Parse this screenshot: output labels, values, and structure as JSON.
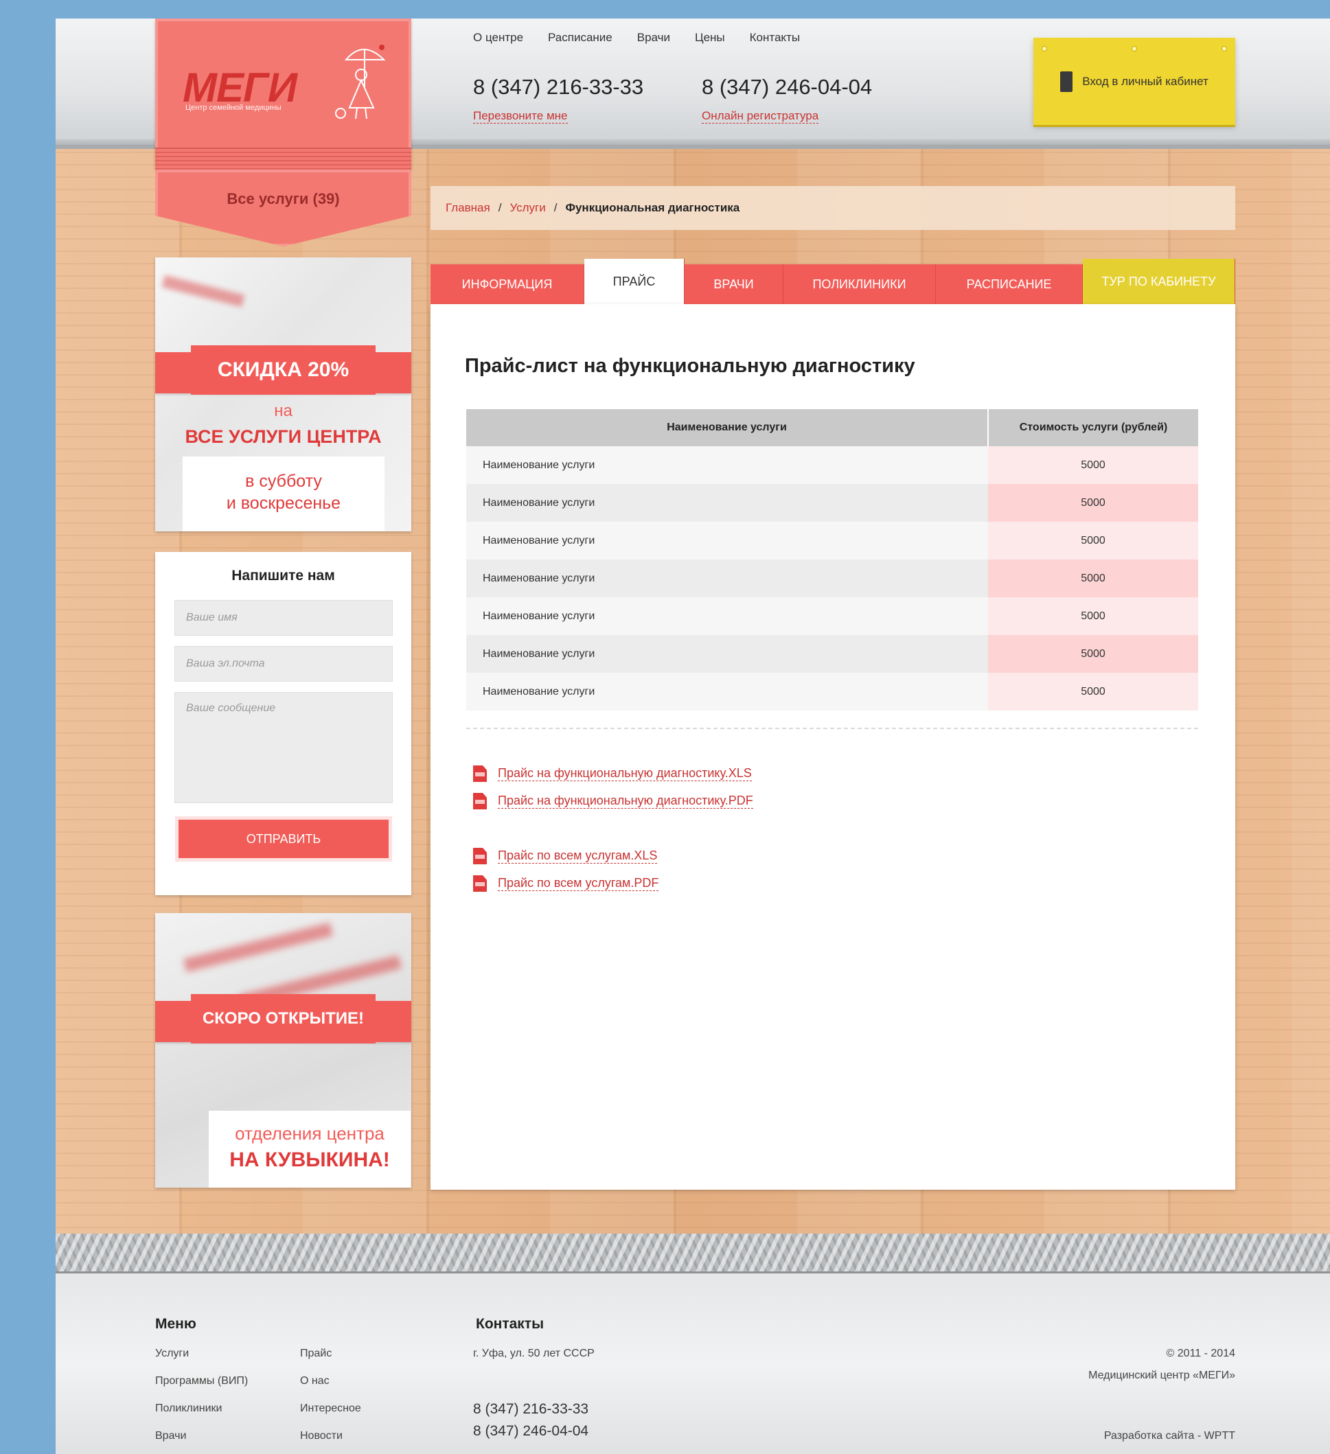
{
  "logo": {
    "name": "МЕГИ",
    "tagline": "Центр семейной медицины"
  },
  "services_ribbon": "Все услуги (39)",
  "topnav": [
    "О центре",
    "Расписание",
    "Врачи",
    "Цены",
    "Контакты"
  ],
  "phones": [
    {
      "number": "8 (347) 216-33-33",
      "link": "Перезвоните мне"
    },
    {
      "number": "8 (347) 246-04-04",
      "link": "Онлайн регистратура"
    }
  ],
  "cabinet_button": "Вход в личный кабинет",
  "breadcrumb": {
    "home": "Главная",
    "sep": "/",
    "services": "Услуги",
    "current": "Функциональная диагностика"
  },
  "tabs": [
    "ИНФОРМАЦИЯ",
    "ПРАЙС",
    "ВРАЧИ",
    "ПОЛИКЛИНИКИ",
    "РАСПИСАНИЕ",
    "ТУР ПО КАБИНЕТУ"
  ],
  "active_tab": "ПРАЙС",
  "main": {
    "title": "Прайс-лист на функциональную диагностику",
    "table": {
      "headers": [
        "Наименование услуги",
        "Стоимость услуги (рублей)"
      ],
      "rows": [
        [
          "Наименование услуги",
          "5000"
        ],
        [
          "Наименование услуги",
          "5000"
        ],
        [
          "Наименование услуги",
          "5000"
        ],
        [
          "Наименование услуги",
          "5000"
        ],
        [
          "Наименование услуги",
          "5000"
        ],
        [
          "Наименование услуги",
          "5000"
        ],
        [
          "Наименование услуги",
          "5000"
        ]
      ]
    },
    "files": [
      "Прайс на функциональную диагностику.XLS",
      "Прайс на функциональную диагностику.PDF",
      "Прайс по всем услугам.XLS",
      "Прайс по всем услугам.PDF"
    ]
  },
  "promo_discount": {
    "headline": "СКИДКА 20%",
    "line1": "на",
    "line2": "ВСЕ УСЛУГИ ЦЕНТРА",
    "line3": "в субботу",
    "line4": "и воскресенье"
  },
  "contact_form": {
    "title": "Напишите нам",
    "name_placeholder": "Ваше имя",
    "email_placeholder": "Ваша эл.почта",
    "message_placeholder": "Ваше сообщение",
    "submit": "ОТПРАВИТЬ"
  },
  "promo_opening": {
    "headline": "СКОРО ОТКРЫТИЕ!",
    "line1": "отделения центра",
    "line2": "НА КУВЫКИНА!"
  },
  "footer": {
    "menu_title": "Меню",
    "menu_col1": [
      "Услуги",
      "Программы (ВИП)",
      "Поликлиники",
      "Врачи"
    ],
    "menu_col2": [
      "Прайс",
      "О нас",
      "Интересное",
      "Новости"
    ],
    "contacts_title": "Контакты",
    "address": "г. Уфа, ул. 50 лет СССР",
    "phone1": "8 (347) 216-33-33",
    "phone2": "8 (347) 246-04-04",
    "copyright": "© 2011 - 2014",
    "company": "Медицинский центр «МЕГИ»",
    "dev": "Разработка сайта - WPTT"
  },
  "colors": {
    "accent": "#f25c58",
    "yellow": "#f0d630",
    "link": "#c93333"
  }
}
